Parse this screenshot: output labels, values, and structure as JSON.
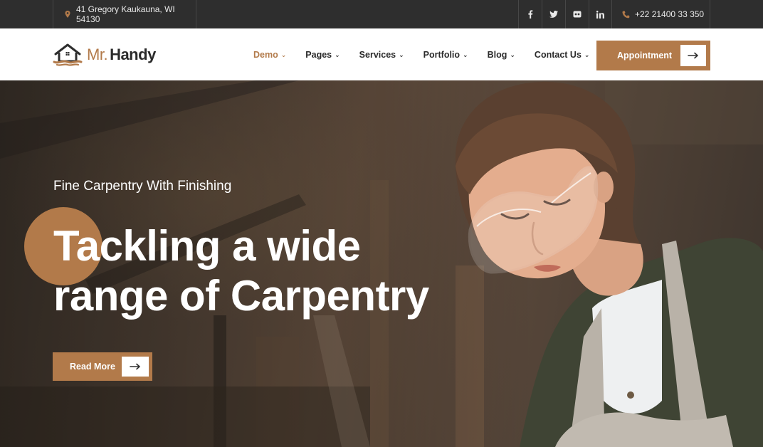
{
  "topbar": {
    "address": "41 Gregory Kaukauna, WI 54130",
    "phone": "+22 21400 33 350",
    "social": [
      {
        "icon": "facebook-icon",
        "glyph": "f"
      },
      {
        "icon": "twitter-icon",
        "glyph": "🐦"
      },
      {
        "icon": "flickr-icon",
        "glyph": "••"
      },
      {
        "icon": "linkedin-icon",
        "glyph": "in"
      }
    ]
  },
  "brand": {
    "prefix": "Mr.",
    "name": "Handy",
    "accent_color": "#b27a4a",
    "dark_color": "#2e2e2e"
  },
  "nav": {
    "items": [
      {
        "label": "Demo",
        "active": true
      },
      {
        "label": "Pages",
        "active": false
      },
      {
        "label": "Services",
        "active": false
      },
      {
        "label": "Portfolio",
        "active": false
      },
      {
        "label": "Blog",
        "active": false
      },
      {
        "label": "Contact Us",
        "active": false
      }
    ],
    "appointment_label": "Appointment"
  },
  "hero": {
    "subtitle": "Fine Carpentry With Finishing",
    "title_line1": "Tackling a wide",
    "title_line2": "range of Carpentry",
    "button_label": "Read More"
  }
}
